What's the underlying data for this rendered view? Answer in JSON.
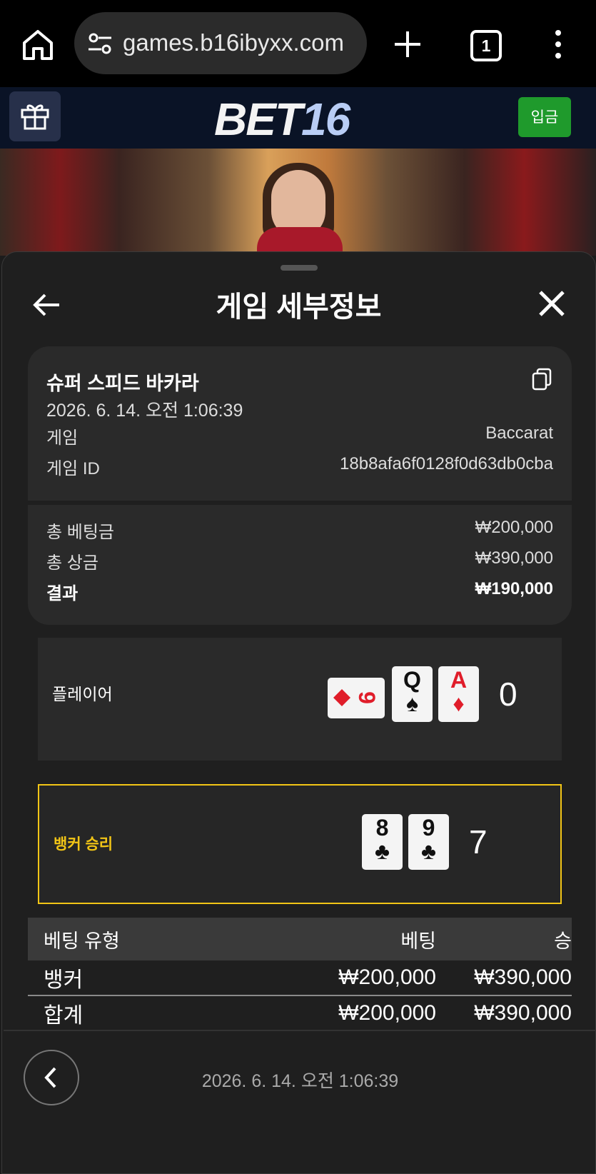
{
  "browser": {
    "url": "games.b16ibyxx.com",
    "tab_count": "1"
  },
  "site": {
    "logo_left": "BET",
    "logo_right": "16",
    "deposit_label": "입금"
  },
  "sheet": {
    "title": "게임 세부정보",
    "game_name": "슈퍼 스피드 바카라",
    "datetime": "2026. 6. 14. 오전 1:06:39",
    "game_label": "게임",
    "game_value": "Baccarat",
    "game_id_label": "게임 ID",
    "game_id_value": "18b8afa6f0128f0d63db0cba",
    "total_bet_label": "총 베팅금",
    "total_bet_value": "₩200,000",
    "total_win_label": "총 상금",
    "total_win_value": "₩390,000",
    "result_label": "결과",
    "result_value": "₩190,000"
  },
  "hands": {
    "player": {
      "label": "플레이어",
      "score": "0",
      "cards": [
        {
          "rank": "9",
          "suit": "♦"
        },
        {
          "rank": "Q",
          "suit": "♠"
        },
        {
          "rank": "A",
          "suit": "♦"
        }
      ]
    },
    "banker": {
      "label": "뱅커 승리",
      "score": "7",
      "cards": [
        {
          "rank": "8",
          "suit": "♣"
        },
        {
          "rank": "9",
          "suit": "♣"
        }
      ]
    }
  },
  "bets": {
    "headers": [
      "베팅 유형",
      "베팅",
      "승"
    ],
    "rows": [
      [
        "뱅커",
        "₩200,000",
        "₩390,000"
      ]
    ],
    "total": [
      "합계",
      "₩200,000",
      "₩390,000"
    ]
  },
  "footer": {
    "datetime": "2026. 6. 14. 오전 1:06:39"
  },
  "colors": {
    "accent_gold": "#f2c516",
    "deposit_green": "#1f9a2c"
  }
}
